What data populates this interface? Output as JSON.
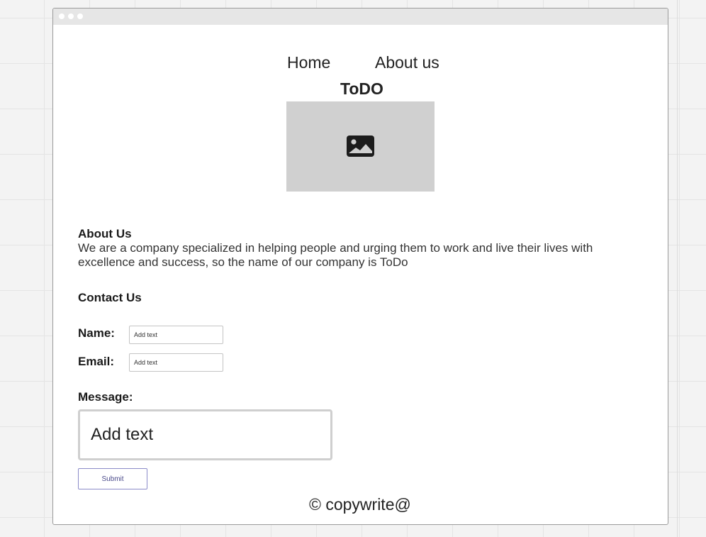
{
  "nav": {
    "home_label": "Home",
    "about_label": "About us"
  },
  "brand": {
    "title": "ToDO"
  },
  "hero": {
    "icon": "image-placeholder-icon"
  },
  "about": {
    "heading": "About Us",
    "body": "We are a company specialized in helping people and urging them to work and live their lives with excellence and success, so the name of our company is ToDo"
  },
  "contact": {
    "heading": "Contact Us",
    "name_label": "Name:",
    "name_placeholder": "Add text",
    "email_label": "Email:",
    "email_placeholder": "Add text",
    "message_label": "Message:",
    "message_placeholder": "Add text",
    "submit_label": "Submit"
  },
  "footer": {
    "text": "© copywrite@"
  },
  "colors": {
    "canvas": "#f3f3f3",
    "window_border": "#9a9a9a",
    "titlebar": "#e6e6e6",
    "placeholder_image": "#d0d0d0",
    "submit_border": "#8b8bc9"
  }
}
